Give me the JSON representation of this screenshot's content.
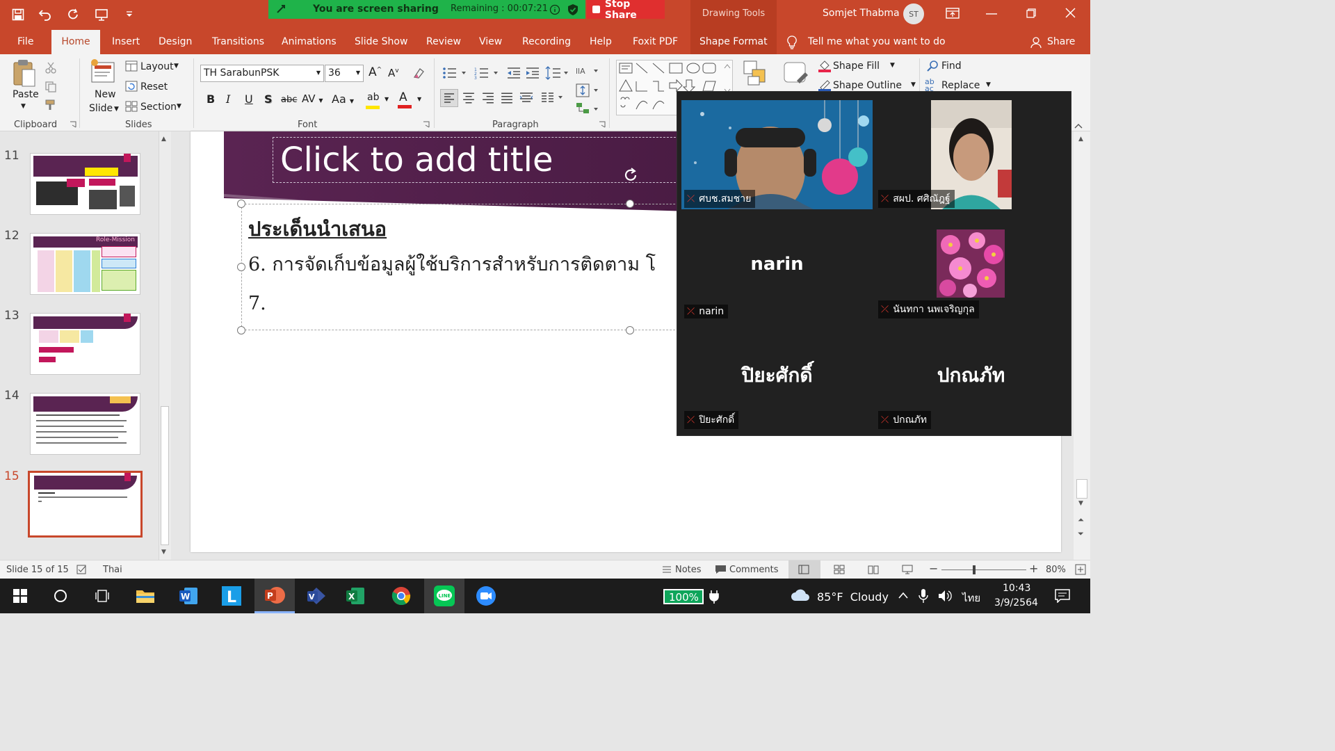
{
  "titlebar": {
    "share_message": "You are screen sharing",
    "remaining": "Remaining : 00:07:21",
    "stop_share": "Stop Share",
    "context_tab": "Drawing Tools",
    "user_name": "Somjet Thabma",
    "user_initials": "ST"
  },
  "menu": {
    "tabs": [
      "File",
      "Home",
      "Insert",
      "Design",
      "Transitions",
      "Animations",
      "Slide Show",
      "Review",
      "View",
      "Recording",
      "Help",
      "Foxit PDF",
      "Shape Format"
    ],
    "tell_me": "Tell me what you want to do",
    "share": "Share"
  },
  "ribbon": {
    "clipboard": {
      "paste": "Paste",
      "group": "Clipboard"
    },
    "slides": {
      "new_slide_line1": "New",
      "new_slide_line2": "Slide",
      "layout": "Layout",
      "reset": "Reset",
      "section": "Section",
      "group": "Slides"
    },
    "font": {
      "family": "TH SarabunPSK",
      "size": "36",
      "change_case": "Aa",
      "group": "Font"
    },
    "paragraph": {
      "group": "Paragraph"
    },
    "drawing": {
      "shape_fill": "Shape Fill",
      "shape_outline": "Shape Outline"
    },
    "editing": {
      "find": "Find",
      "replace": "Replace"
    }
  },
  "thumbnails": [
    {
      "number": "11"
    },
    {
      "number": "12",
      "tag": "Role-Mission"
    },
    {
      "number": "13"
    },
    {
      "number": "14"
    },
    {
      "number": "15",
      "selected": true
    }
  ],
  "slide": {
    "title_placeholder": "Click to add title",
    "heading": "ประเด็นนำเสนอ",
    "items": [
      "6. การจัดเก็บข้อมูลผู้ใช้บริการสำหรับการติดตาม โ",
      "7."
    ]
  },
  "meeting": {
    "participants": [
      {
        "name": "ศบช.สมชาย",
        "video": true
      },
      {
        "name": "สผป. ศศิณัฎฐ์",
        "video": true
      },
      {
        "name": "narin",
        "display": "narin"
      },
      {
        "name": "นันทกา นพเจริญกุล",
        "picture": "pink flowers"
      },
      {
        "name": "ปิยะศักดิ์",
        "display": "ปิยะศักดิ์"
      },
      {
        "name": "ปกณภัท",
        "display": "ปกณภัท"
      }
    ]
  },
  "status": {
    "slide_indicator": "Slide 15 of 15",
    "language": "Thai",
    "notes": "Notes",
    "comments": "Comments",
    "zoom": "80%",
    "zoom_fraction": 0.8
  },
  "taskbar": {
    "battery": "100%",
    "weather": "85°F  Cloudy",
    "lang": "ไทย",
    "time": "10:43",
    "date": "3/9/2564"
  },
  "colors": {
    "accent": "#c8472b",
    "share_green": "#1fb34a",
    "stop_red": "#e02f2f",
    "slide_purple": "#5a2452"
  }
}
